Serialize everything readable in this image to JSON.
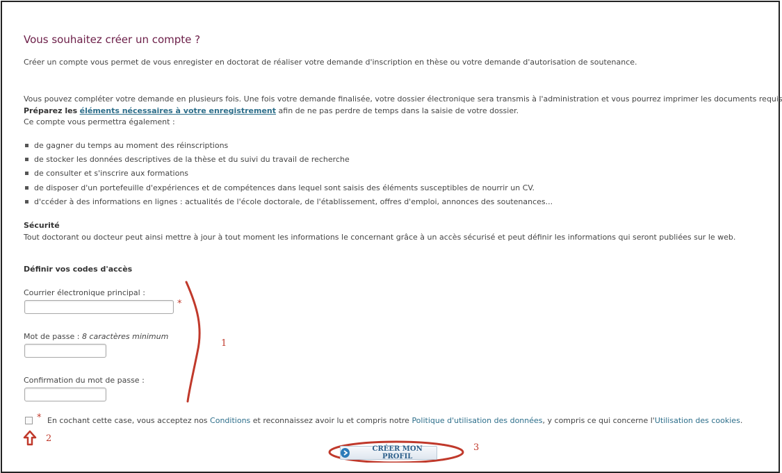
{
  "header": {
    "title": "Vous souhaitez créer un compte ?"
  },
  "intro": {
    "line1": "Créer un compte vous permet de vous enregister en doctorat de réaliser votre demande d'inscription en thèse ou votre demande d'autorisation de soutenance.",
    "line2": "Vous pouvez compléter votre demande en plusieurs fois. Une fois votre demande finalisée, votre dossier électronique sera transmis à l'administration et vous pourrez imprimer les documents requis.",
    "prepare_bold": "Préparez les",
    "prepare_link": "éléments nécessaires à votre enregistrement",
    "prepare_rest": "afin de ne pas perdre de temps dans la saisie de votre dossier.",
    "line4": "Ce compte vous permettra également :"
  },
  "benefits": [
    "de gagner du temps au moment des réinscriptions",
    "de stocker les données descriptives de la thèse et du suivi du travail de recherche",
    "de consulter et s'inscrire aux formations",
    "de disposer d'un portefeuille d'expériences et de compétences dans lequel sont saisis des éléments susceptibles de nourrir un CV.",
    "d'ccéder à des informations en lignes : actualités de l'école doctorale, de l'établissement, offres d'emploi, annonces des soutenances..."
  ],
  "security": {
    "heading": "Sécurité",
    "text": "Tout doctorant ou docteur peut ainsi mettre à jour à tout moment les informations le concernant grâce à un accès sécurisé et peut définir les informations qui seront publiées sur le web."
  },
  "form": {
    "heading": "Définir vos codes d'accès",
    "email_label": "Courrier électronique principal :",
    "email_value": "",
    "required_mark": "*",
    "password_label": "Mot de passe :",
    "password_hint": "8 caractères minimum",
    "password_value": "",
    "confirm_label": "Confirmation du mot de passe :",
    "confirm_value": ""
  },
  "consent": {
    "required_mark": "*",
    "text1": "En cochant cette case, vous acceptez nos",
    "link_conditions": "Conditions",
    "text2": "et reconnaissez avoir lu et compris notre",
    "link_policy": "Politique d'utilisation des données",
    "text3": ", y compris ce qui concerne l'",
    "link_cookies": "Utilisation des cookies",
    "text4": "."
  },
  "submit": {
    "label": "CRÉER MON PROFIL"
  },
  "annotations": {
    "one": "1",
    "two": "2",
    "three": "3",
    "color": "#c0392b"
  }
}
